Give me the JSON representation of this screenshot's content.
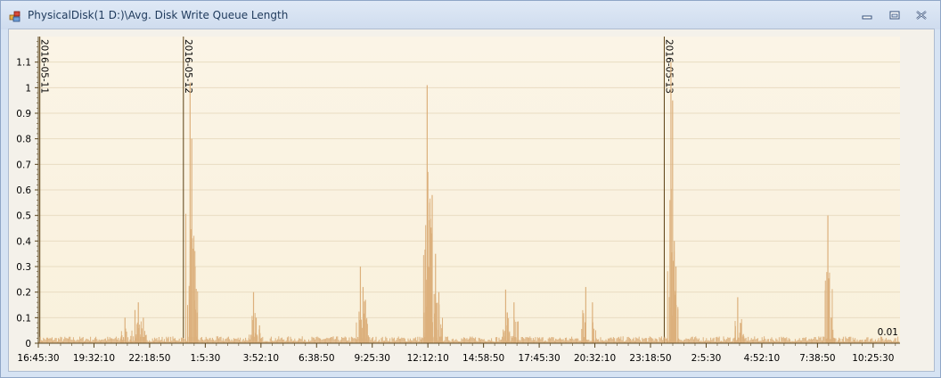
{
  "window": {
    "title": "PhysicalDisk(1 D:)\\Avg. Disk Write Queue Length",
    "icons": {
      "app": "chart-app-icon",
      "minimize": "minimize-icon",
      "restore": "restore-icon",
      "close": "close-icon"
    }
  },
  "colors": {
    "series": "#dcb07c",
    "marker": "#5a3e12",
    "plot_bg_top": "#fbf4e6",
    "plot_bg_bottom": "#f9f1dc",
    "grid": "#e9dcc2",
    "axis": "#5a4620"
  },
  "chart_data": {
    "type": "area",
    "title": "",
    "xlabel": "",
    "ylabel": "",
    "ylim": [
      0,
      1.2
    ],
    "yticks": [
      0,
      0.1,
      0.2,
      0.3,
      0.4,
      0.5,
      0.6,
      0.7,
      0.8,
      0.9,
      1,
      1.1
    ],
    "ytick_labels": [
      "0",
      "0.1",
      "0.2",
      "0.3",
      "0.4",
      "0.5",
      "0.6",
      "0.7",
      "0.8",
      "0.9",
      "1",
      "1.1"
    ],
    "xlim": [
      "2016-05-11 16:45:30",
      "2016-05-13 11:46:00"
    ],
    "xtick_labels": [
      "16:45:30",
      "19:32:10",
      "22:18:50",
      "1:5:30",
      "3:52:10",
      "6:38:50",
      "9:25:30",
      "12:12:10",
      "14:58:50",
      "17:45:30",
      "20:32:10",
      "23:18:50",
      "2:5:30",
      "4:52:10",
      "7:38:50",
      "10:25:30"
    ],
    "xticks": [
      "2016-05-11 16:45:30",
      "2016-05-11 19:32:10",
      "2016-05-11 22:18:50",
      "2016-05-12 01:05:30",
      "2016-05-12 03:52:10",
      "2016-05-12 06:38:50",
      "2016-05-12 09:25:30",
      "2016-05-12 12:12:10",
      "2016-05-12 14:58:50",
      "2016-05-12 17:45:30",
      "2016-05-12 20:32:10",
      "2016-05-12 23:18:50",
      "2016-05-13 02:05:30",
      "2016-05-13 04:52:10",
      "2016-05-13 07:38:50",
      "2016-05-13 10:25:30"
    ],
    "date_markers": [
      {
        "label": "2016-05-11",
        "x": "2016-05-11 16:50:00"
      },
      {
        "label": "2016-05-12",
        "x": "2016-05-12 00:00:00"
      },
      {
        "label": "2016-05-13",
        "x": "2016-05-13 00:00:00"
      }
    ],
    "last_value_label": "0.01",
    "baseline": 0.015,
    "series": [
      {
        "x": [
          "2016-05-11 21:05:00",
          "2016-05-11 21:35:00",
          "2016-05-11 21:45:00",
          "2016-05-11 22:00:00",
          "2016-05-12 00:20:00",
          "2016-05-12 00:25:00",
          "2016-05-12 00:30:00",
          "2016-05-12 00:35:00",
          "2016-05-12 03:30:00",
          "2016-05-12 03:38:00",
          "2016-05-12 03:48:00",
          "2016-05-12 08:50:00",
          "2016-05-12 08:58:00",
          "2016-05-12 09:05:00",
          "2016-05-12 12:00:00",
          "2016-05-12 12:10:00",
          "2016-05-12 12:12:00",
          "2016-05-12 12:18:00",
          "2016-05-12 12:22:00",
          "2016-05-12 12:25:00",
          "2016-05-12 12:35:00",
          "2016-05-12 12:45:00",
          "2016-05-12 16:05:00",
          "2016-05-12 16:10:00",
          "2016-05-12 16:30:00",
          "2016-05-12 20:05:00",
          "2016-05-12 20:25:00",
          "2016-05-13 00:20:00",
          "2016-05-13 00:25:00",
          "2016-05-13 00:30:00",
          "2016-05-13 00:35:00",
          "2016-05-13 03:40:00",
          "2016-05-13 03:48:00",
          "2016-05-13 08:10:00",
          "2016-05-13 08:20:00"
        ],
        "y": [
          0.1,
          0.13,
          0.16,
          0.1,
          1.02,
          0.8,
          0.37,
          0.3,
          0.2,
          0.1,
          0.07,
          0.3,
          0.22,
          0.17,
          0.12,
          1.01,
          0.67,
          0.55,
          0.43,
          0.58,
          0.35,
          0.2,
          0.21,
          0.12,
          0.16,
          0.22,
          0.16,
          1.1,
          0.95,
          0.4,
          0.3,
          0.18,
          0.08,
          0.5,
          0.1
        ]
      }
    ]
  }
}
